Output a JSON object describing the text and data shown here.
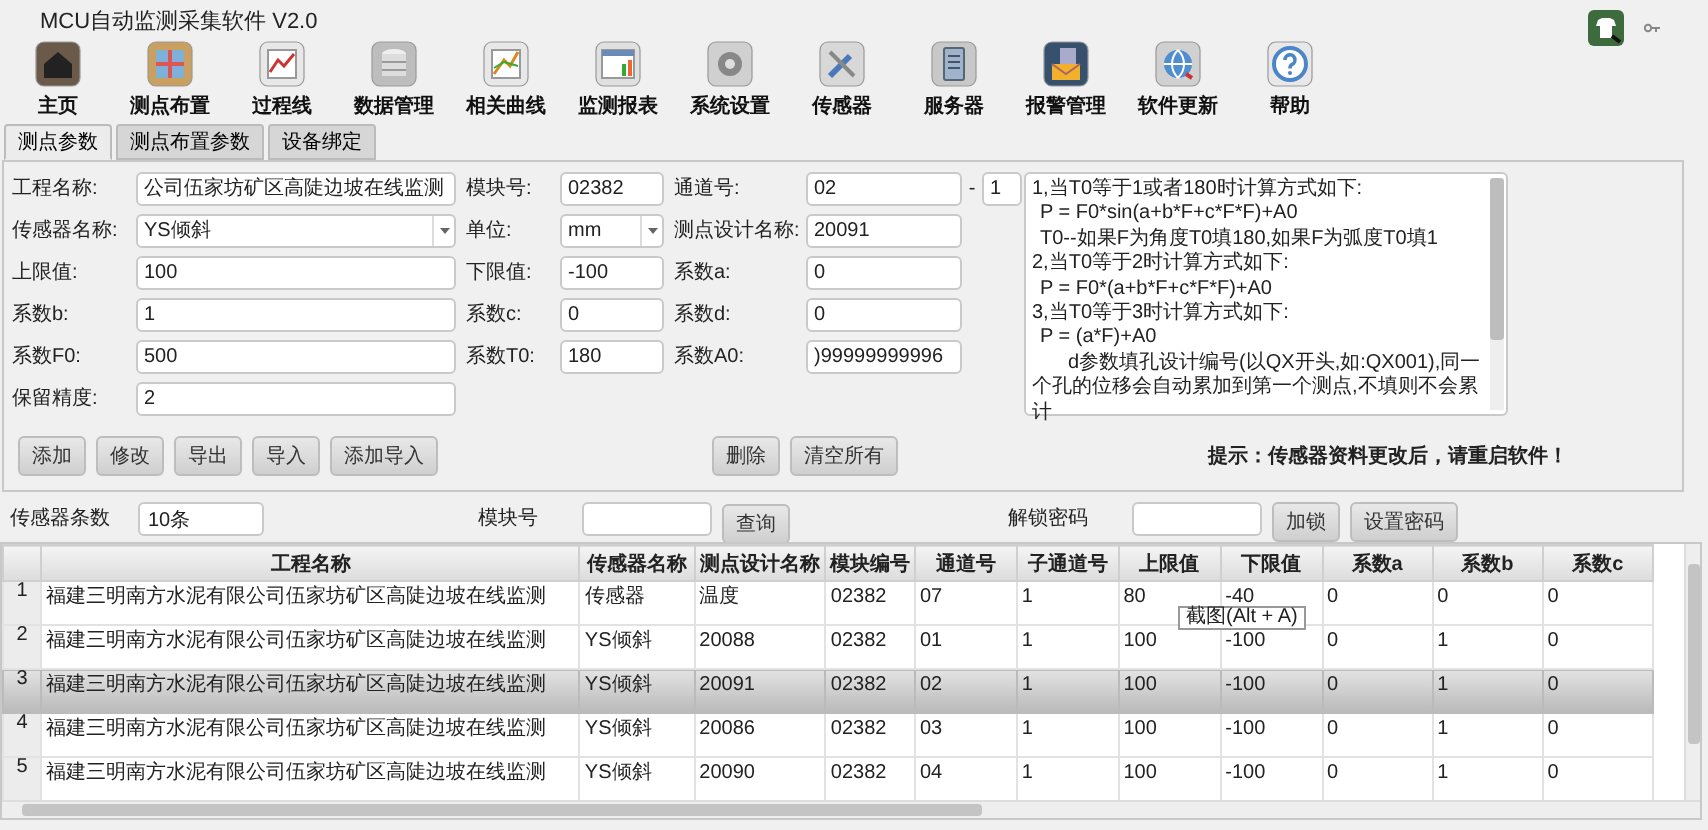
{
  "window": {
    "title": "MCU自动监测采集软件 V2.0"
  },
  "toolbar": [
    {
      "label": "主页"
    },
    {
      "label": "测点布置"
    },
    {
      "label": "过程线"
    },
    {
      "label": "数据管理"
    },
    {
      "label": "相关曲线"
    },
    {
      "label": "监测报表"
    },
    {
      "label": "系统设置"
    },
    {
      "label": "传感器"
    },
    {
      "label": "服务器"
    },
    {
      "label": "报警管理"
    },
    {
      "label": "软件更新"
    },
    {
      "label": "帮助"
    }
  ],
  "tabs": [
    {
      "label": "测点参数",
      "selected": true
    },
    {
      "label": "测点布置参数",
      "selected": false
    },
    {
      "label": "设备绑定",
      "selected": false
    }
  ],
  "form": {
    "rows": [
      [
        {
          "label": "工程名称:",
          "value": "公司伍家坊矿区高陡边坡在线监测",
          "kind": "text"
        },
        {
          "label": "模块号:",
          "value": "02382",
          "kind": "text"
        },
        {
          "label": "通道号:",
          "value": "02",
          "kind": "text",
          "separator": "-",
          "second_value": "1"
        }
      ],
      [
        {
          "label": "传感器名称:",
          "value": "YS倾斜",
          "kind": "select"
        },
        {
          "label": "单位:",
          "value": "mm",
          "kind": "select"
        },
        {
          "label": "测点设计名称:",
          "value": "20091",
          "kind": "text"
        }
      ],
      [
        {
          "label": "上限值:",
          "value": "100",
          "kind": "text"
        },
        {
          "label": "下限值:",
          "value": "-100",
          "kind": "text"
        },
        {
          "label": "系数a:",
          "value": "0",
          "kind": "text"
        }
      ],
      [
        {
          "label": "系数b:",
          "value": "1",
          "kind": "text"
        },
        {
          "label": "系数c:",
          "value": "0",
          "kind": "text"
        },
        {
          "label": "系数d:",
          "value": "0",
          "kind": "text"
        }
      ],
      [
        {
          "label": "系数F0:",
          "value": "500",
          "kind": "text"
        },
        {
          "label": "系数T0:",
          "value": "180",
          "kind": "text"
        },
        {
          "label": "系数A0:",
          "value": ")99999999996",
          "kind": "text"
        }
      ],
      [
        {
          "label": "保留精度:",
          "value": "2",
          "kind": "text"
        }
      ]
    ]
  },
  "formula_notes": [
    {
      "text": "1,当T0等于1或者180时计算方式如下:",
      "kind": "heading"
    },
    {
      "text": "P = F0*sin(a+b*F+c*F*F)+A0",
      "kind": "formula"
    },
    {
      "text": "T0--如果F为角度T0填180,如果F为弧度T0填1",
      "kind": "formula"
    },
    {
      "text": "2,当T0等于2时计算方式如下:",
      "kind": "heading"
    },
    {
      "text": "P = F0*(a+b*F+c*F*F)+A0",
      "kind": "formula"
    },
    {
      "text": "3,当T0等于3时计算方式如下:",
      "kind": "heading"
    },
    {
      "text": "P = (a*F)+A0",
      "kind": "formula"
    },
    {
      "text": "d参数填孔设计编号(以QX开头,如:QX001),同一个孔的位移会自动累加到第一个测点,不填则不会累计",
      "kind": "note"
    }
  ],
  "left_buttons": [
    "添加",
    "修改",
    "导出",
    "导入",
    "添加导入"
  ],
  "right_buttons": [
    "删除",
    "清空所有"
  ],
  "hint": "提示：传感器资料更改后，请重启软件！",
  "filter": {
    "count_label": "传感器条数",
    "count_value": "10条",
    "module_label": "模块号",
    "query_button": "查询",
    "unlock_label": "解锁密码",
    "lock_button": "加锁",
    "password_button": "设置密码"
  },
  "table": {
    "columns": [
      "工程名称",
      "传感器名称",
      "测点设计名称",
      "模块编号",
      "通道号",
      "子通道号",
      "上限值",
      "下限值",
      "系数a",
      "系数b",
      "系数c"
    ],
    "rows": [
      {
        "index": "1",
        "selected": false,
        "cells": [
          "福建三明南方水泥有限公司伍家坊矿区高陡边坡在线监测",
          "传感器",
          "温度",
          "02382",
          "07",
          "1",
          "80",
          "-40",
          "0",
          "0",
          "0"
        ]
      },
      {
        "index": "2",
        "selected": false,
        "cells": [
          "福建三明南方水泥有限公司伍家坊矿区高陡边坡在线监测",
          "YS倾斜",
          "20088",
          "02382",
          "01",
          "1",
          "100",
          "-100",
          "0",
          "1",
          "0"
        ]
      },
      {
        "index": "3",
        "selected": true,
        "cells": [
          "福建三明南方水泥有限公司伍家坊矿区高陡边坡在线监测",
          "YS倾斜",
          "20091",
          "02382",
          "02",
          "1",
          "100",
          "-100",
          "0",
          "1",
          "0"
        ]
      },
      {
        "index": "4",
        "selected": false,
        "cells": [
          "福建三明南方水泥有限公司伍家坊矿区高陡边坡在线监测",
          "YS倾斜",
          "20086",
          "02382",
          "03",
          "1",
          "100",
          "-100",
          "0",
          "1",
          "0"
        ]
      },
      {
        "index": "5",
        "selected": false,
        "cells": [
          "福建三明南方水泥有限公司伍家坊矿区高陡边坡在线监测",
          "YS倾斜",
          "20090",
          "02382",
          "04",
          "1",
          "100",
          "-100",
          "0",
          "1",
          "0"
        ]
      }
    ]
  },
  "tooltip": "截图(Alt + A)"
}
